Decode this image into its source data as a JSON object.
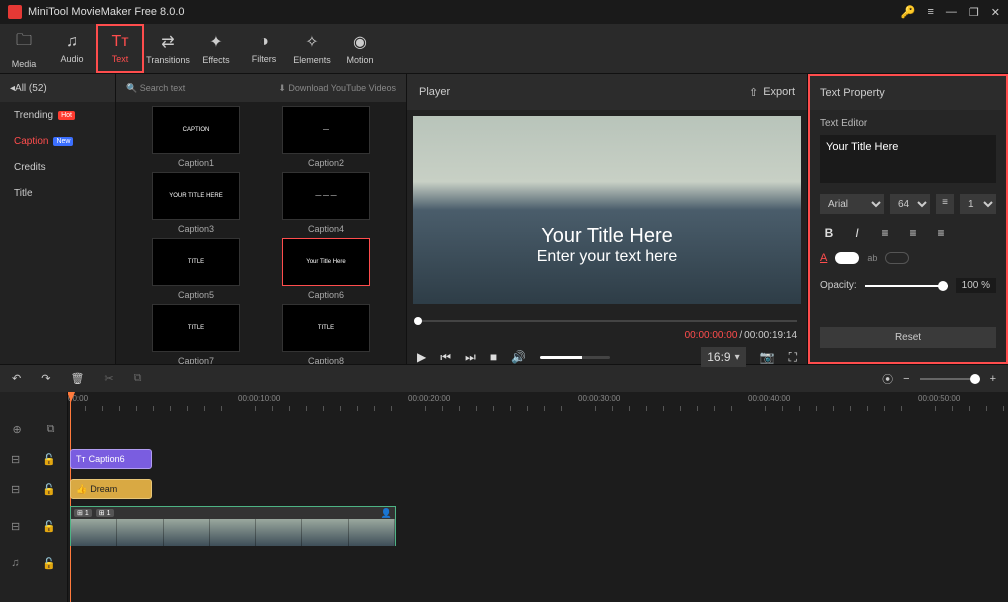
{
  "app": {
    "title": "MiniTool MovieMaker Free 8.0.0"
  },
  "toolbar": {
    "items": [
      {
        "label": "Media"
      },
      {
        "label": "Audio"
      },
      {
        "label": "Text"
      },
      {
        "label": "Transitions"
      },
      {
        "label": "Effects"
      },
      {
        "label": "Filters"
      },
      {
        "label": "Elements"
      },
      {
        "label": "Motion"
      }
    ]
  },
  "sidebar": {
    "header": "All (52)",
    "items": [
      {
        "label": "Trending",
        "badge": "Hot"
      },
      {
        "label": "Caption",
        "badge": "New"
      },
      {
        "label": "Credits"
      },
      {
        "label": "Title"
      }
    ]
  },
  "captions": {
    "search": "Search text",
    "download": "Download YouTube Videos",
    "rows": [
      [
        {
          "name": "Caption1",
          "txt": "CAPTION"
        },
        {
          "name": "Caption2",
          "txt": "—"
        }
      ],
      [
        {
          "name": "Caption3",
          "txt": "YOUR TITLE HERE"
        },
        {
          "name": "Caption4",
          "txt": "— — —"
        }
      ],
      [
        {
          "name": "Caption5",
          "txt": "TITLE"
        },
        {
          "name": "Caption6",
          "txt": "Your Title Here",
          "selected": true
        }
      ],
      [
        {
          "name": "Caption7",
          "txt": "TITLE"
        },
        {
          "name": "Caption8",
          "txt": "TITLE"
        }
      ]
    ]
  },
  "player": {
    "header": "Player",
    "export": "Export",
    "overlay_title": "Your Title Here",
    "overlay_subtitle": "Enter your text here",
    "time_current": "00:00:00:00",
    "time_duration": "00:00:19:14",
    "ratio": "16:9"
  },
  "props": {
    "header": "Text Property",
    "editor_label": "Text Editor",
    "text_value": "Your Title Here",
    "font": "Arial",
    "size": "64",
    "line": "1",
    "opacity_label": "Opacity:",
    "opacity_value": "100 %",
    "reset": "Reset"
  },
  "timeline": {
    "ruler": [
      "00:00",
      "00:00:10:00",
      "00:00:20:00",
      "00:00:30:00",
      "00:00:40:00",
      "00:00:50:00"
    ],
    "clip_caption": "Caption6",
    "clip_audio": "Dream",
    "vtag1": "1",
    "vtag2": "1"
  }
}
